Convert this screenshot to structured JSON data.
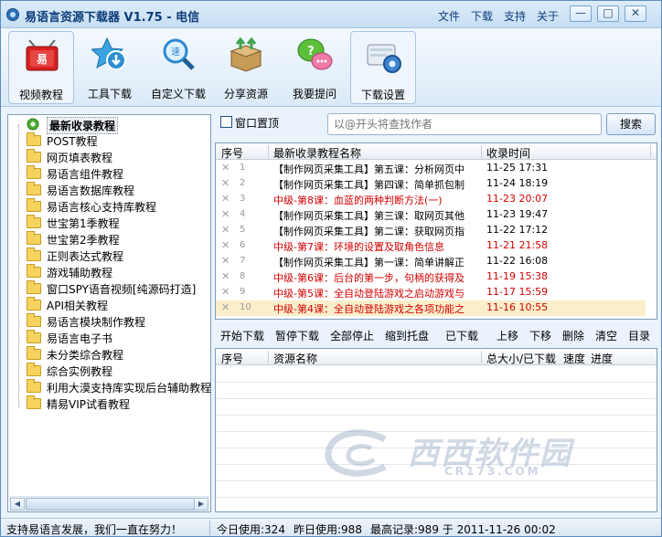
{
  "window": {
    "title": "易语言资源下载器 V1.75 - 电信",
    "menu": [
      "文件",
      "下载",
      "支持",
      "关于"
    ],
    "controls": [
      "—",
      "□",
      "✕"
    ]
  },
  "toolbar": [
    {
      "label": "视频教程",
      "icon": "video-icon",
      "active": true
    },
    {
      "label": "工具下载",
      "icon": "download-star-icon",
      "active": false
    },
    {
      "label": "自定义下载",
      "icon": "magnifier-icon",
      "active": false
    },
    {
      "label": "分享资源",
      "icon": "share-box-icon",
      "active": false
    },
    {
      "label": "我要提问",
      "icon": "chat-bubbles-icon",
      "active": false
    },
    {
      "label": "下载设置",
      "icon": "settings-gear-icon",
      "active": true
    }
  ],
  "tree": [
    "最新收录教程",
    "POST教程",
    "网页填表教程",
    "易语言组件教程",
    "易语言数据库教程",
    "易语言核心支持库教程",
    "世宝第1季教程",
    "世宝第2季教程",
    "正则表达式教程",
    "游戏辅助教程",
    "窗口SPY语音视频[纯源码打造]",
    "API相关教程",
    "易语言模块制作教程",
    "易语言电子书",
    "未分类综合教程",
    "综合实例教程",
    "利用大漠支持库实现后台辅助教程",
    "精易VIP试看教程"
  ],
  "search": {
    "window_top_label": "窗口置顶",
    "placeholder": "以@开头将查找作者",
    "button": "搜索"
  },
  "course_list": {
    "columns": [
      "序号",
      "最新收录教程名称",
      "收录时间"
    ],
    "rows": [
      {
        "n": "1",
        "title": "【制作网页采集工具】第五课：分析网页中",
        "time": "11-25 17:31",
        "red": false
      },
      {
        "n": "2",
        "title": "【制作网页采集工具】第四课：简单抓包制",
        "time": "11-24 18:19",
        "red": false
      },
      {
        "n": "3",
        "title": "中级-第8课：血蓝的两种判断方法(一)",
        "time": "11-23 20:07",
        "red": true
      },
      {
        "n": "4",
        "title": "【制作网页采集工具】第三课：取网页其他",
        "time": "11-23 19:47",
        "red": false
      },
      {
        "n": "5",
        "title": "【制作网页采集工具】第二课：获取网页指",
        "time": "11-22 17:12",
        "red": false
      },
      {
        "n": "6",
        "title": "中级-第7课：环境的设置及取角色信息",
        "time": "11-21 21:58",
        "red": true
      },
      {
        "n": "7",
        "title": "【制作网页采集工具】第一课：简单讲解正",
        "time": "11-22 16:08",
        "red": false
      },
      {
        "n": "8",
        "title": "中级-第6课：后台的第一步，句柄的获得及",
        "time": "11-19 15:38",
        "red": true
      },
      {
        "n": "9",
        "title": "中级-第5课：全自动登陆游戏之启动游戏与",
        "time": "11-17 15:59",
        "red": true
      },
      {
        "n": "10",
        "title": "中级-第4课：全自动登陆游戏之各项功能之",
        "time": "11-16 10:55",
        "red": true
      }
    ]
  },
  "actions": [
    "开始下载",
    "暂停下载",
    "全部停止",
    "缩到托盘",
    "已下载",
    "上移",
    "下移",
    "删除",
    "清空",
    "目录"
  ],
  "download_list": {
    "columns": [
      "序号",
      "资源名称",
      "总大小/已下载",
      "速度",
      "进度"
    ]
  },
  "watermark": {
    "text": "西西软件园",
    "sub": "CR173.COM"
  },
  "status": {
    "left": "支持易语言发展，我们一直在努力！",
    "today": "今日使用:324",
    "yesterday": "昨日使用:988",
    "record": "最高记录:989 于 2011-11-26 00:02"
  }
}
